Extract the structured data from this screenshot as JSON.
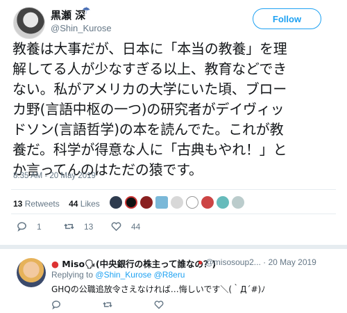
{
  "tweet": {
    "author_name": "黒瀬 深",
    "author_emoji": "☂",
    "handle": "@Shin_Kurose",
    "follow_label": "Follow",
    "lines": [
      "教養は大事だが、日本に「本当の教養」を理",
      "解してる人が少なすぎる以上、教育などでき",
      "ない。私がアメリカの大学にいた頃、ブロー",
      "カ野(言語中枢の一つ)の研究者がデイヴィッ",
      "ドソン(言語哲学)の本を読んでた。これが教",
      "養だ。科学が得意な人に「古典もやれ！」と",
      "か言ってんのはただの猿です。"
    ],
    "timestamp": "8:35 AM - 20 May 2019"
  },
  "stats": {
    "retweets_count": "13",
    "retweets_label": "Retweets",
    "likes_count": "44",
    "likes_label": "Likes"
  },
  "actions": {
    "reply_count": "1",
    "retweet_count": "13",
    "like_count": "44"
  },
  "reply": {
    "name": "Miso🗣(中央銀行の株主って誰なの？)",
    "handle_date": "@misosoup2... · 20 May 2019",
    "replying_prefix": "Replying to",
    "replying_to": "@Shin_Kurose @R8eru",
    "text": "GHQの公職追放令さえなければ…悔しいです＼(｀Д´#)ﾉ"
  },
  "colors": {
    "accent": "#1da1f2",
    "muted": "#657786"
  }
}
